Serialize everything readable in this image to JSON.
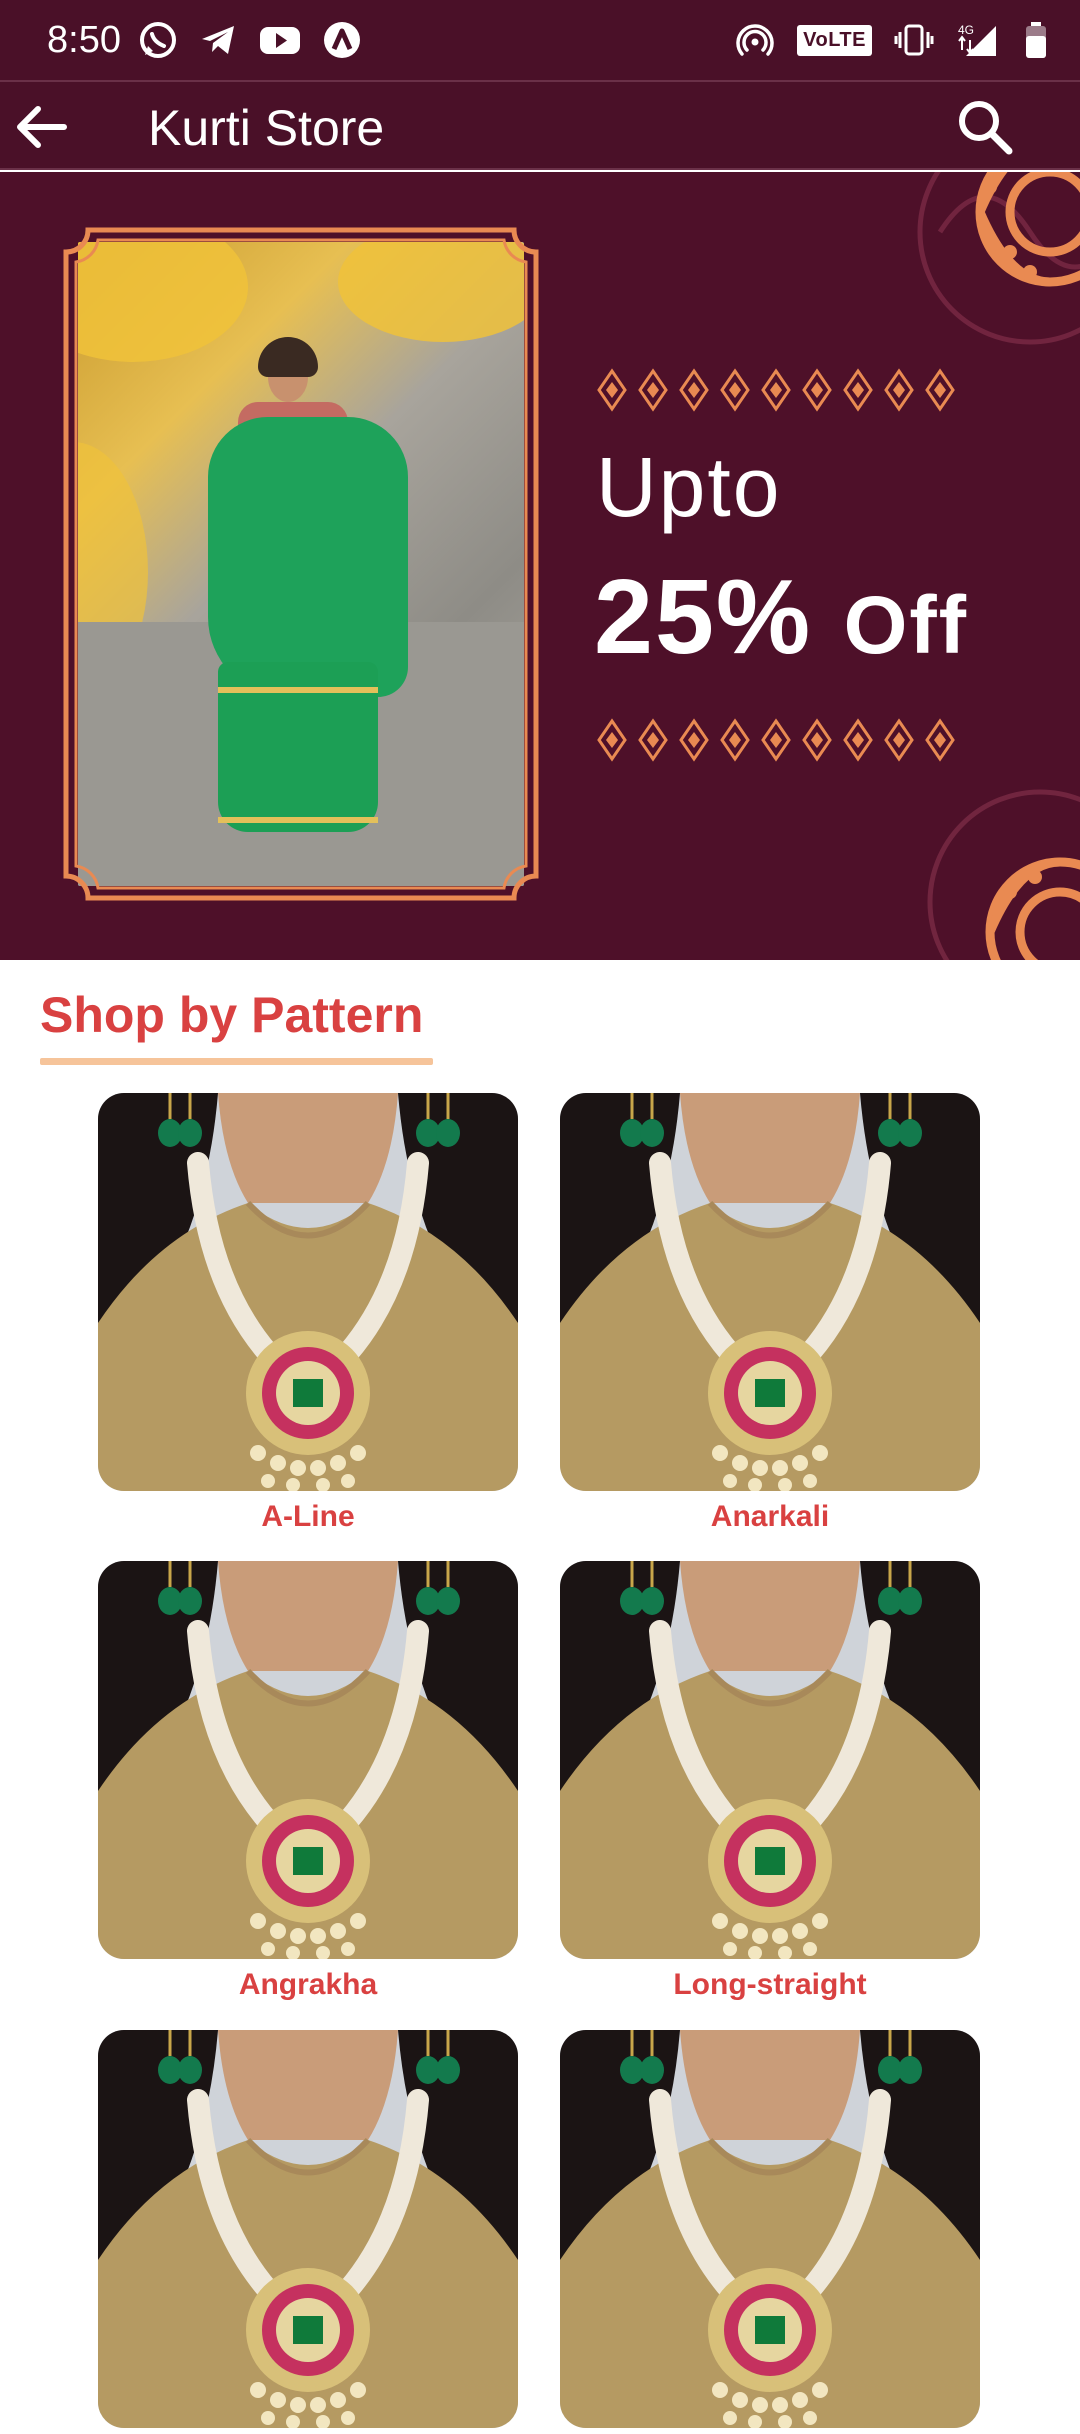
{
  "status_bar": {
    "time": "8:50",
    "left_icons": [
      "whatsapp-icon",
      "telegram-icon",
      "youtube-icon",
      "app-launcher-icon"
    ],
    "right_icons": [
      "hotspot-icon",
      "volte-icon",
      "vibrate-icon",
      "signal-4g-icon",
      "battery-icon"
    ],
    "volte_label": "VoLTE"
  },
  "app_bar": {
    "title": "Kurti Store",
    "back_icon": "arrow-left-icon",
    "search_icon": "search-icon"
  },
  "banner": {
    "line1": "Upto",
    "discount": "25%",
    "off": "Off",
    "colors": {
      "background": "#4e1029",
      "accent": "#e98a52"
    }
  },
  "section": {
    "title": "Shop by Pattern"
  },
  "patterns": [
    {
      "label": "A-Line"
    },
    {
      "label": "Anarkali"
    },
    {
      "label": "Angrakha"
    },
    {
      "label": "Long-straight"
    },
    {
      "label": ""
    },
    {
      "label": ""
    }
  ],
  "colors": {
    "primary": "#4a1028",
    "label": "#d94141",
    "underline": "#f6c49a"
  }
}
